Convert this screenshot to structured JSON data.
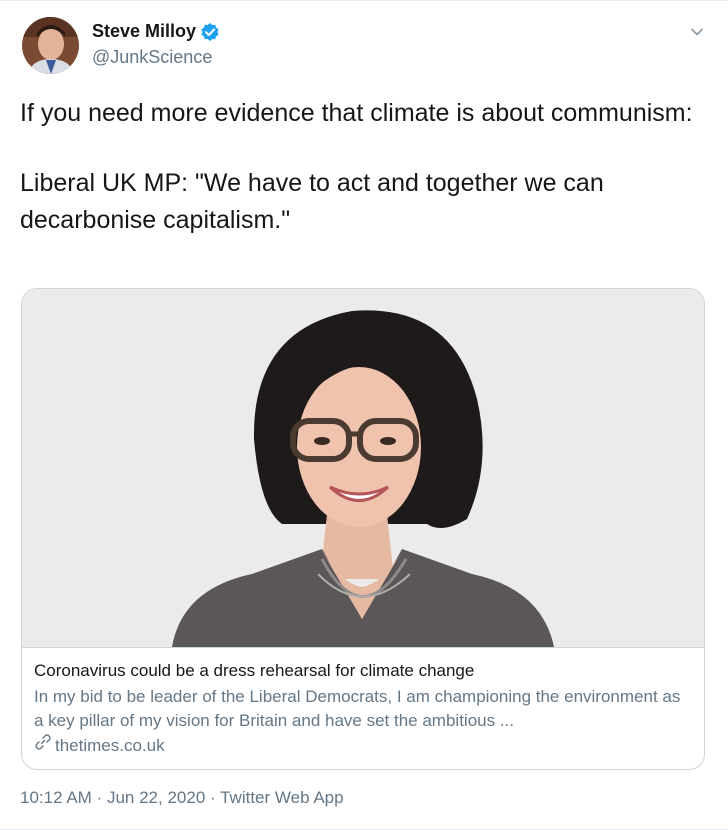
{
  "author": {
    "display_name": "Steve Milloy",
    "handle": "@JunkScience",
    "verified_icon": "verified-badge-icon"
  },
  "tweet": {
    "paragraphs": [
      "If you need more evidence that climate is about communism:",
      "Liberal UK MP: \"We have to act and together we can decarbonise capitalism.\""
    ]
  },
  "card": {
    "title": "Coronavirus could be a dress rehearsal for climate change",
    "description": "In my bid to be leader of the Liberal Democrats, I am championing the environment as a key pillar of my vision for Britain and have set the ambitious ...",
    "domain": "thetimes.co.uk",
    "domain_icon": "link-icon"
  },
  "meta": {
    "time": "10:12 AM",
    "date": "Jun 22, 2020",
    "source": "Twitter Web App",
    "separator": "·"
  },
  "colors": {
    "text": "#14171a",
    "secondary": "#657786",
    "verified": "#1da1f2",
    "border": "#ccd6dd"
  }
}
